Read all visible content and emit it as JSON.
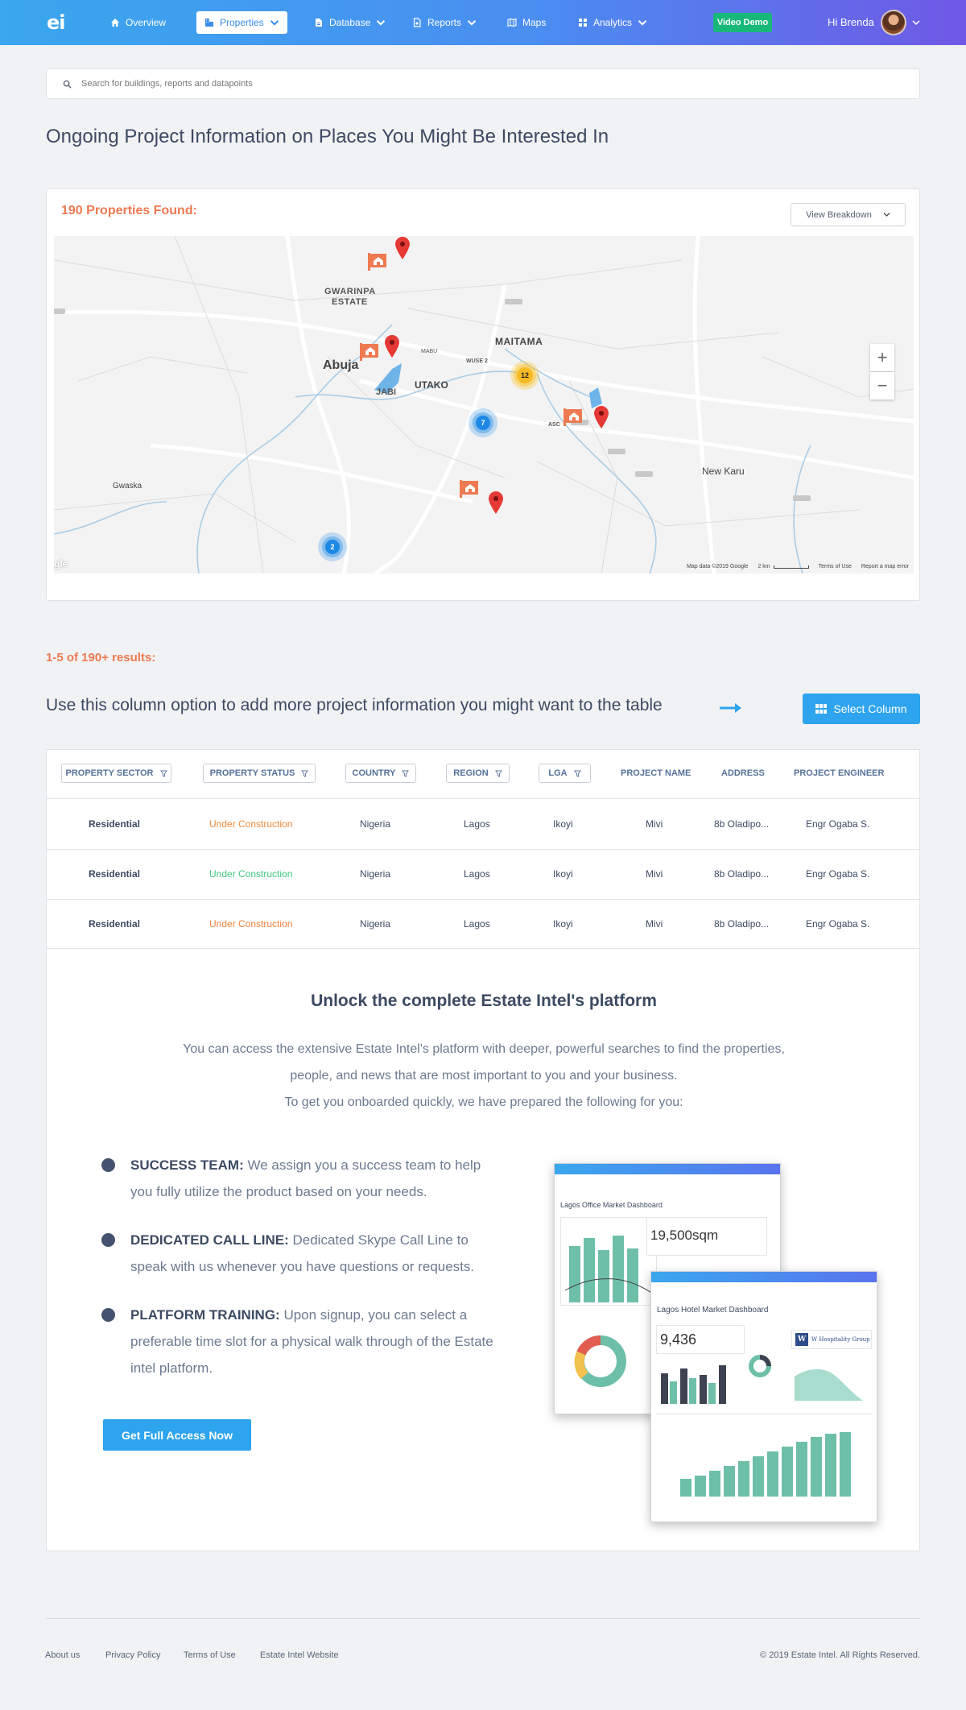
{
  "nav": {
    "logo": "ei",
    "items": [
      {
        "label": "Overview",
        "icon": "home-icon"
      },
      {
        "label": "Properties",
        "icon": "building-icon",
        "active": true
      },
      {
        "label": "Database",
        "icon": "database-icon"
      },
      {
        "label": "Reports",
        "icon": "report-icon"
      },
      {
        "label": "Maps",
        "icon": "map-icon"
      },
      {
        "label": "Analytics",
        "icon": "analytics-icon"
      }
    ],
    "demo_label": "Video Demo",
    "greeting": "Hi Brenda"
  },
  "search": {
    "placeholder": "Search for buildings, reports and datapoints"
  },
  "page_title": "Ongoing Project Information on Places You Might Be Interested In",
  "map_card": {
    "found": "190 Properties Found:",
    "breakdown_label": "View Breakdown",
    "labels": {
      "gwarinpa": "GWARINPA",
      "estate": "ESTATE",
      "maitama": "MAITAMA",
      "abuja": "Abuja",
      "jabi": "JABI",
      "utako": "UTAKO",
      "mabu": "MABU",
      "wuse": "WUSE 2",
      "new_karu": "New Karu",
      "gwaska": "Gwaska",
      "asc": "ASC"
    },
    "clusters": [
      "12",
      "7",
      "2"
    ],
    "attribution": {
      "data": "Map data ©2019 Google",
      "scale": "2 km",
      "terms": "Terms of Use",
      "report": "Report a map error",
      "google": "gle"
    },
    "zoom_in": "+",
    "zoom_out": "−"
  },
  "results_count": "1-5 of 190+ results:",
  "column_hint": "Use this column option to add more project information you might want to the table",
  "select_column_label": "Select Column",
  "table": {
    "filters": [
      "PROPERTY SECTOR",
      "PROPERTY STATUS",
      "COUNTRY",
      "REGION",
      "LGA"
    ],
    "headers": [
      "PROJECT NAME",
      "ADDRESS",
      "PROJECT ENGINEER"
    ],
    "rows": [
      {
        "sector": "Residential",
        "status": "Under Construction",
        "status_color": "#f08a3c",
        "country": "Nigeria",
        "region": "Lagos",
        "lga": "Ikoyi",
        "project": "Mivi",
        "address": "8b Oladipo...",
        "engineer": "Engr Ogaba  S."
      },
      {
        "sector": "Residential",
        "status": "Under Construction",
        "status_color": "#3fc87e",
        "country": "Nigeria",
        "region": "Lagos",
        "lga": "Ikoyi",
        "project": "Mivi",
        "address": "8b Oladipo...",
        "engineer": "Engr Ogaba  S."
      },
      {
        "sector": "Residential",
        "status": "Under Construction",
        "status_color": "#f0813c",
        "country": "Nigeria",
        "region": "Lagos",
        "lga": "Ikoyi",
        "project": "Mivi",
        "address": "8b Oladipo...",
        "engineer": "Engr Ogaba  S."
      }
    ]
  },
  "unlock": {
    "title": "Unlock the complete Estate Intel's platform",
    "desc1": "You can access the extensive Estate Intel's platform with deeper, powerful searches to find the properties, people, and news that are most important to you and your business.",
    "desc2": "To get you onboarded quickly, we have prepared the following for you:",
    "bullets": [
      {
        "head": "SUCCESS TEAM:",
        "text": " We assign you a success team to help you fully utilize the product based on your needs."
      },
      {
        "head": "DEDICATED CALL LINE:",
        "text": " Dedicated Skype Call Line to speak with us whenever you have questions or requests."
      },
      {
        "head": "PLATFORM TRAINING:",
        "text": " Upon signup, you can select a preferable time slot for a physical walk through of the Estate intel platform."
      }
    ],
    "cta_label": "Get Full Access Now",
    "shot1": {
      "title": "Lagos Office Market Dashboard",
      "value": "19,500sqm"
    },
    "shot2": {
      "title": "Lagos Hotel Market Dashboard",
      "value": "9,436",
      "brand": "W Hospitality Group",
      "brand_mark": "W"
    }
  },
  "footer": {
    "links": [
      "About us",
      "Privacy Policy",
      "Terms of Use",
      "Estate Intel Website"
    ],
    "copyright": "© 2019 Estate Intel. All Rights Reserved."
  },
  "colors": {
    "accent": "#2ea4ee",
    "orange": "#ee7a52",
    "green_demo": "#18b87a",
    "teal_chart": "#6dbfa8"
  }
}
